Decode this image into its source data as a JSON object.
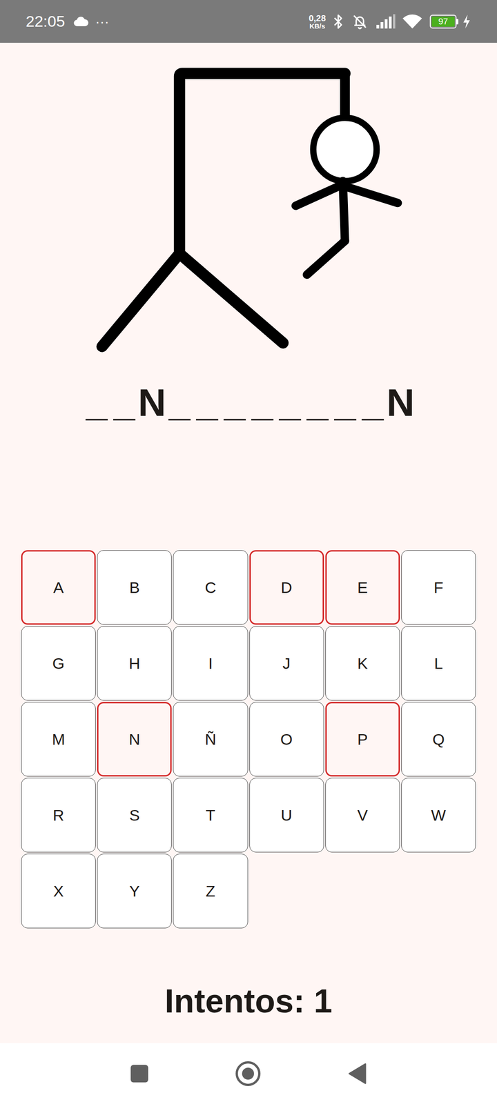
{
  "status_bar": {
    "time": "22:05",
    "more": "···",
    "speed": "0,28",
    "speed_unit": "KB/s",
    "battery": "97"
  },
  "hangman": {
    "parts": [
      {
        "kind": "gallows",
        "shown": true
      },
      {
        "kind": "rope",
        "shown": true
      },
      {
        "kind": "head",
        "shown": true
      },
      {
        "kind": "body",
        "shown": true
      },
      {
        "kind": "leftarm",
        "shown": true
      },
      {
        "kind": "rightarm",
        "shown": true
      },
      {
        "kind": "leftleg",
        "shown": true
      },
      {
        "kind": "rightleg",
        "shown": false
      }
    ]
  },
  "word": [
    {
      "char": "_",
      "revealed": false
    },
    {
      "char": "_",
      "revealed": false
    },
    {
      "char": "N",
      "revealed": true
    },
    {
      "char": "_",
      "revealed": false
    },
    {
      "char": "_",
      "revealed": false
    },
    {
      "char": "_",
      "revealed": false
    },
    {
      "char": "_",
      "revealed": false
    },
    {
      "char": "_",
      "revealed": false
    },
    {
      "char": "_",
      "revealed": false
    },
    {
      "char": "_",
      "revealed": false
    },
    {
      "char": "_",
      "revealed": false
    },
    {
      "char": "N",
      "revealed": true
    }
  ],
  "keys": [
    {
      "label": "A",
      "selected": true
    },
    {
      "label": "B",
      "selected": false
    },
    {
      "label": "C",
      "selected": false
    },
    {
      "label": "D",
      "selected": true
    },
    {
      "label": "E",
      "selected": true
    },
    {
      "label": "F",
      "selected": false
    },
    {
      "label": "G",
      "selected": false
    },
    {
      "label": "H",
      "selected": false
    },
    {
      "label": "I",
      "selected": false
    },
    {
      "label": "J",
      "selected": false
    },
    {
      "label": "K",
      "selected": false
    },
    {
      "label": "L",
      "selected": false
    },
    {
      "label": "M",
      "selected": false
    },
    {
      "label": "N",
      "selected": true
    },
    {
      "label": "Ñ",
      "selected": false
    },
    {
      "label": "O",
      "selected": false
    },
    {
      "label": "P",
      "selected": true
    },
    {
      "label": "Q",
      "selected": false
    },
    {
      "label": "R",
      "selected": false
    },
    {
      "label": "S",
      "selected": false
    },
    {
      "label": "T",
      "selected": false
    },
    {
      "label": "U",
      "selected": false
    },
    {
      "label": "V",
      "selected": false
    },
    {
      "label": "W",
      "selected": false
    },
    {
      "label": "X",
      "selected": false
    },
    {
      "label": "Y",
      "selected": false
    },
    {
      "label": "Z",
      "selected": false
    }
  ],
  "attempts": "Intentos: 1"
}
